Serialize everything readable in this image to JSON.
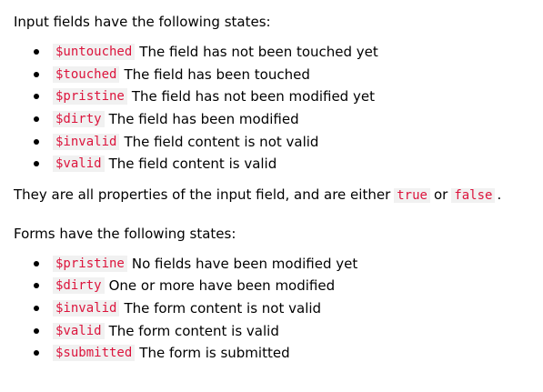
{
  "input_section": {
    "intro": "Input fields have the following states:",
    "states": [
      {
        "name": "$untouched",
        "description": "The field has not been touched yet"
      },
      {
        "name": "$touched",
        "description": "The field has been touched"
      },
      {
        "name": "$pristine",
        "description": "The field has not been modified yet"
      },
      {
        "name": "$dirty",
        "description": "The field has been modified"
      },
      {
        "name": "$invalid",
        "description": "The field content is not valid"
      },
      {
        "name": "$valid",
        "description": "The field content is valid"
      }
    ]
  },
  "summary": {
    "text_before": "They are all properties of the input field, and are either",
    "true_value": "true",
    "text_or": "or",
    "false_value": "false",
    "text_end": "."
  },
  "form_section": {
    "intro": "Forms have the following states:",
    "states": [
      {
        "name": "$pristine",
        "description": "No fields have been modified yet"
      },
      {
        "name": "$dirty",
        "description": "One or more have been modified"
      },
      {
        "name": "$invalid",
        "description": "The form content is not valid"
      },
      {
        "name": "$valid",
        "description": "The form content is valid"
      },
      {
        "name": "$submitted",
        "description": "The form is submitted"
      }
    ]
  },
  "colors": {
    "code_text": "#dc143c",
    "code_background": "#f1f1f1",
    "text": "#000000"
  }
}
